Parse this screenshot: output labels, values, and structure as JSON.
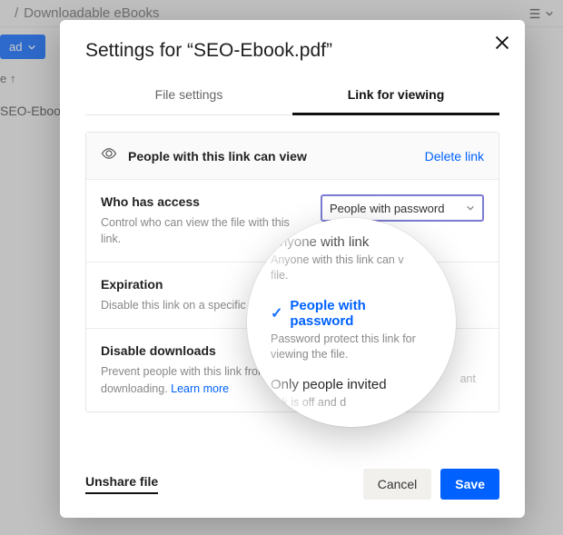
{
  "bg": {
    "breadcrumb": "Downloadable eBooks",
    "upload": "ad",
    "row2_suffix": "e ↑",
    "file": "SEO-Ebook"
  },
  "modal": {
    "title": "Settings for “SEO-Ebook.pdf”",
    "tabs": {
      "file": "File settings",
      "link": "Link for viewing"
    },
    "panel": {
      "head": "People with this link can view",
      "delete": "Delete link"
    },
    "access": {
      "label": "Who has access",
      "sub": "Control who can view the file with this link.",
      "selected": "People with password"
    },
    "expiration": {
      "label": "Expiration",
      "sub": "Disable this link on a specific date"
    },
    "downloads": {
      "label": "Disable downloads",
      "sub_pre": "Prevent people with this link from downloading. ",
      "learn": "Learn more"
    },
    "footer": {
      "unshare": "Unshare file",
      "cancel": "Cancel",
      "save": "Save"
    },
    "ant": "ant"
  },
  "options": {
    "anyone": {
      "title": "Anyone with link",
      "desc_a": "Anyone with this link can v",
      "desc_b": "file."
    },
    "password": {
      "title": "People with password",
      "desc": "Password protect this link for viewing the file."
    },
    "invited": {
      "title": "Only people invited",
      "desc": "link is off and d"
    }
  }
}
